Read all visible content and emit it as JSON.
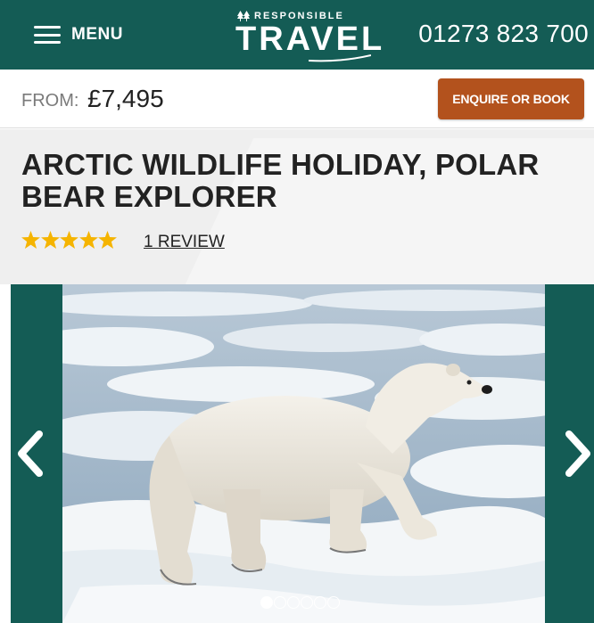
{
  "header": {
    "menu_label": "MENU",
    "logo_top": "RESPONSIBLE",
    "logo_main": "TRAVEL",
    "phone": "01273 823 700"
  },
  "price_bar": {
    "from_label": "FROM:",
    "price": "£7,495",
    "enquire_label": "ENQUIRE OR BOOK"
  },
  "trip": {
    "title": "ARCTIC WILDLIFE HOLIDAY, POLAR BEAR EXPLORER",
    "rating_stars": 5,
    "review_link": "1 REVIEW"
  },
  "gallery": {
    "image": "polar-bear-on-sea-ice",
    "slide_count": 6,
    "active_slide": 1
  },
  "colors": {
    "brand_green": "#145c55",
    "button_orange": "#b3521d",
    "star_yellow": "#f5b400"
  }
}
